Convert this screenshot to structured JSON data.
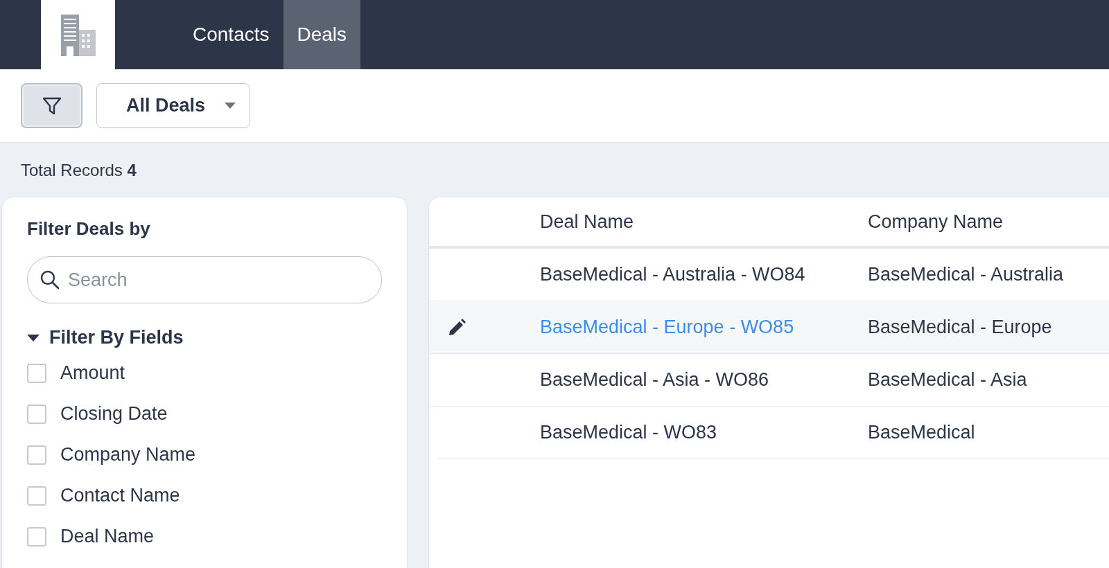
{
  "nav": {
    "tabs": [
      {
        "label": "Contacts",
        "selected": false
      },
      {
        "label": "Deals",
        "selected": true
      }
    ]
  },
  "toolbar": {
    "view_dropdown": {
      "value": "All Deals"
    }
  },
  "summary": {
    "label": "Total Records",
    "count": "4"
  },
  "filter_panel": {
    "title": "Filter Deals by",
    "search": {
      "placeholder": "Search"
    },
    "section": {
      "title": "Filter By Fields",
      "expanded": true,
      "fields": [
        {
          "label": "Amount",
          "checked": false
        },
        {
          "label": "Closing Date",
          "checked": false
        },
        {
          "label": "Company Name",
          "checked": false
        },
        {
          "label": "Contact Name",
          "checked": false
        },
        {
          "label": "Deal Name",
          "checked": false
        }
      ]
    }
  },
  "table": {
    "columns": [
      "Deal Name",
      "Company Name"
    ],
    "rows": [
      {
        "deal_name": "BaseMedical - Australia - WO84",
        "company_name": "BaseMedical - Australia",
        "selected": false
      },
      {
        "deal_name": "BaseMedical - Europe - WO85",
        "company_name": "BaseMedical - Europe",
        "selected": true
      },
      {
        "deal_name": "BaseMedical - Asia - WO86",
        "company_name": "BaseMedical - Asia",
        "selected": false
      },
      {
        "deal_name": "BaseMedical - WO83",
        "company_name": "BaseMedical",
        "selected": false
      }
    ]
  }
}
